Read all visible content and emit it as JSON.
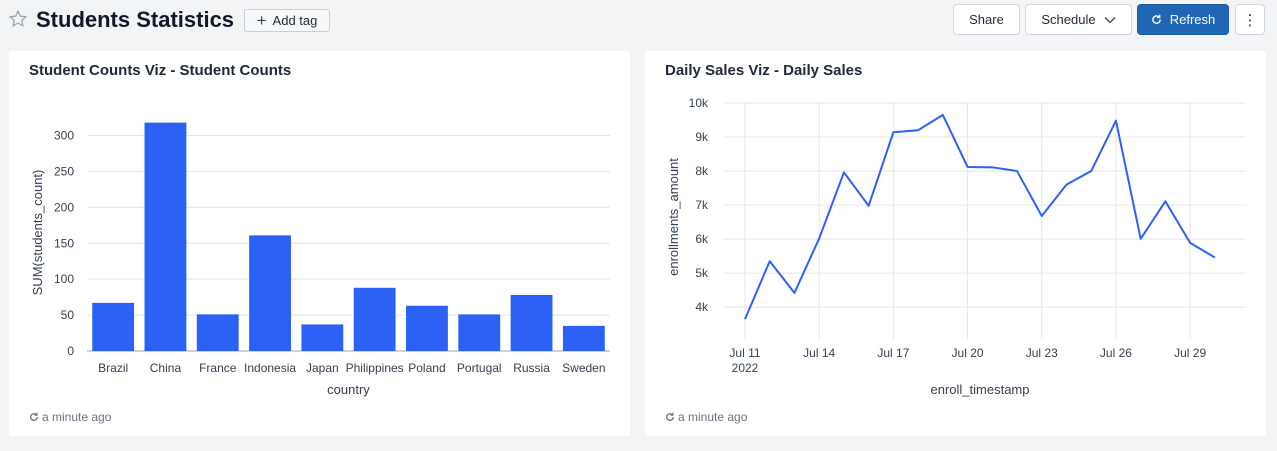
{
  "header": {
    "title": "Students Statistics",
    "add_tag_label": "Add tag",
    "share_label": "Share",
    "schedule_label": "Schedule",
    "refresh_label": "Refresh",
    "more_label": "⋮"
  },
  "cards": [
    {
      "title": "Student Counts Viz - Student Counts",
      "footer": "a minute ago"
    },
    {
      "title": "Daily Sales Viz - Daily Sales",
      "footer": "a minute ago"
    }
  ],
  "colors": {
    "series": "#2b62f5",
    "grid": "#e5e7eb",
    "axis": "#374151",
    "primary_button": "#2166b5"
  },
  "chart_data": [
    {
      "type": "bar",
      "categories": [
        "Brazil",
        "China",
        "France",
        "Indonesia",
        "Japan",
        "Philippines",
        "Poland",
        "Portugal",
        "Russia",
        "Sweden"
      ],
      "values": [
        67,
        318,
        51,
        161,
        37,
        88,
        63,
        51,
        78,
        35
      ],
      "xlabel": "country",
      "ylabel": "SUM(students_count)",
      "ylim": [
        0,
        330
      ],
      "yticks": [
        0,
        50,
        100,
        150,
        200,
        250,
        300
      ],
      "grid": true
    },
    {
      "type": "line",
      "x": [
        "2022-07-11",
        "2022-07-12",
        "2022-07-13",
        "2022-07-14",
        "2022-07-15",
        "2022-07-16",
        "2022-07-17",
        "2022-07-18",
        "2022-07-19",
        "2022-07-20",
        "2022-07-21",
        "2022-07-22",
        "2022-07-23",
        "2022-07-24",
        "2022-07-25",
        "2022-07-26",
        "2022-07-27",
        "2022-07-28",
        "2022-07-29",
        "2022-07-30"
      ],
      "values": [
        3650,
        5350,
        4420,
        6020,
        7960,
        6980,
        9140,
        9200,
        9650,
        8120,
        8110,
        8000,
        6680,
        7600,
        8000,
        9480,
        6010,
        7110,
        5890,
        5460
      ],
      "xlabel": "enroll_timestamp",
      "ylabel": "enrollments_amount",
      "ylim": [
        3300,
        10000
      ],
      "yticks": [
        4000,
        5000,
        6000,
        7000,
        8000,
        9000,
        10000
      ],
      "ytick_labels": [
        "4k",
        "5k",
        "6k",
        "7k",
        "8k",
        "9k",
        "10k"
      ],
      "xtick_labels": [
        "Jul 11",
        "Jul 14",
        "Jul 17",
        "Jul 20",
        "Jul 23",
        "Jul 26",
        "Jul 29"
      ],
      "xtick_sublabel": "2022",
      "grid": true
    }
  ]
}
